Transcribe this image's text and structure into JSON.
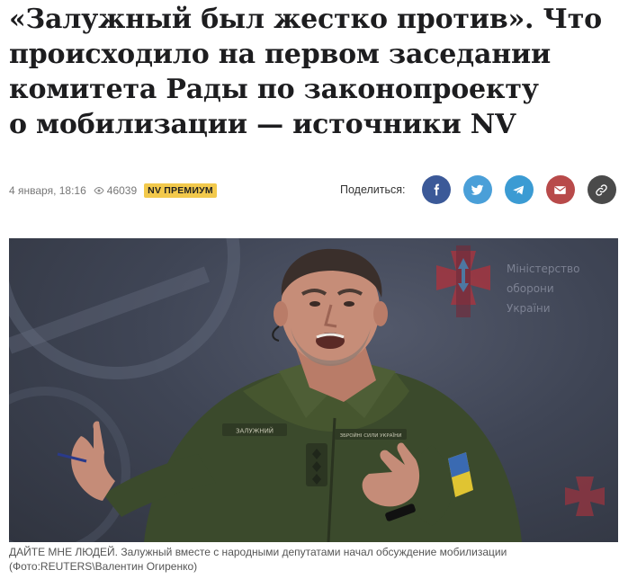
{
  "article": {
    "title_lines": [
      "«Залужный был жестко против». Что",
      "происходило на первом заседании",
      "комитета Рады по законопроекту",
      "о мобилизации — источники NV"
    ],
    "date": "4 января, 18:16",
    "views": "46039",
    "premium_badge": "NV ПРЕМИУМ"
  },
  "share": {
    "label": "Поделиться:",
    "buttons": [
      {
        "name": "facebook",
        "icon": "facebook-icon",
        "color": "#3b5998"
      },
      {
        "name": "twitter",
        "icon": "twitter-icon",
        "color": "#4a9fd8"
      },
      {
        "name": "telegram",
        "icon": "telegram-icon",
        "color": "#3b9bd3"
      },
      {
        "name": "email",
        "icon": "mail-icon",
        "color": "#b84a4a"
      },
      {
        "name": "copy-link",
        "icon": "link-icon",
        "color": "#4a4a4a"
      }
    ]
  },
  "photo": {
    "background_text": [
      "Міністерство",
      "оборони",
      "України"
    ],
    "name_tag": "ЗАЛУЖНИЙ",
    "chest_patch": "ЗБРОЙНІ СИЛИ УКРАЇНИ",
    "caption_line1": "ДАЙТЕ МНЕ ЛЮДЕЙ. Залужный вместе с народными депутатами начал обсуждение мобилизации",
    "caption_line2": "(Фото:REUTERS\\Валентин Огиренко)"
  }
}
